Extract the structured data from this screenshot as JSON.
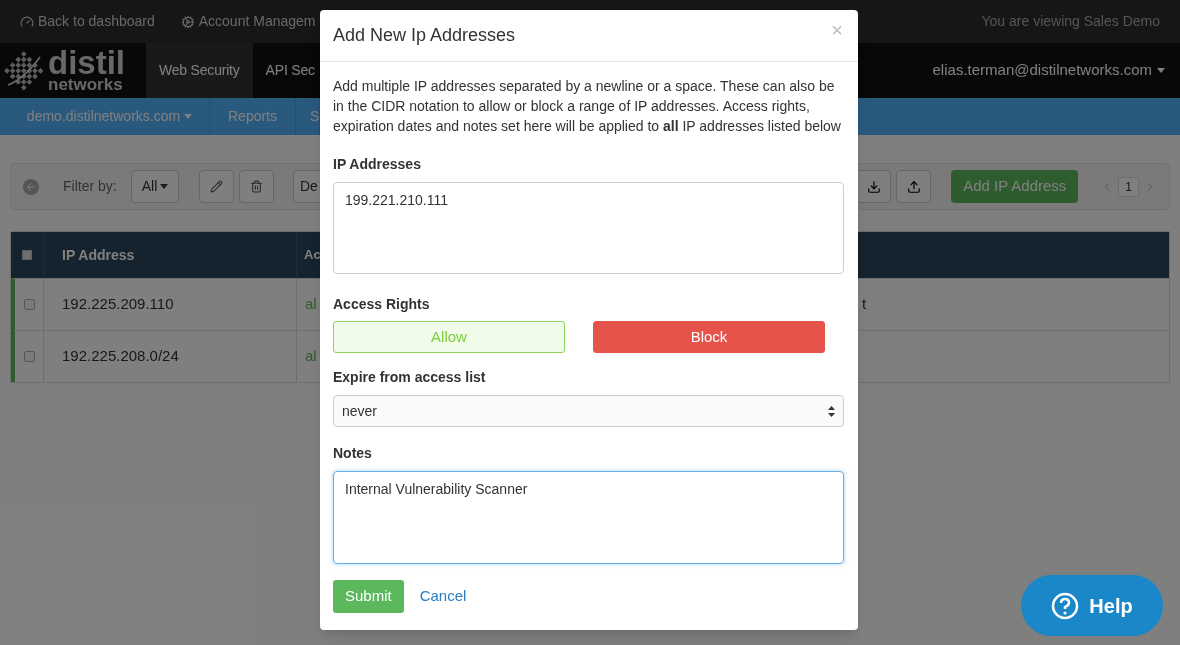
{
  "top_bar": {
    "links": [
      {
        "label": "Back to dashboard"
      },
      {
        "label": "Account Managem"
      }
    ],
    "viewing": "You are viewing Sales Demo"
  },
  "nav": {
    "logo": {
      "word": "distil",
      "sub": "networks"
    },
    "tabs": [
      {
        "label": "Web Security",
        "selected": true
      },
      {
        "label": "API Sec",
        "selected": false
      }
    ],
    "user": "elias.terman@distilnetworks.com"
  },
  "subnav": {
    "items": [
      {
        "label": "demo.distilnetworks.com",
        "dropdown": true
      },
      {
        "label": "Reports",
        "dropdown": false
      },
      {
        "label": "S",
        "dropdown": false
      }
    ]
  },
  "toolbar": {
    "filter_label": "Filter by:",
    "filter_value": "All",
    "cut_button": "De",
    "add_button": "Add IP Address",
    "page": "1"
  },
  "table": {
    "select_all_checked": false,
    "columns": [
      "IP Address",
      "Ac"
    ],
    "rows": [
      {
        "ip": "192.225.209.110",
        "access": "al",
        "column_3": "t",
        "checked": false
      },
      {
        "ip": "192.225.208.0/24",
        "access": "al",
        "checked": false
      }
    ]
  },
  "modal": {
    "title": "Add New Ip Addresses",
    "close": "×",
    "description": "Add multiple IP addresses separated by a newline or a space. These can also be in the CIDR notation to allow or block a range of IP addresses. Access rights, expiration dates and notes set here will be applied to **all** IP addresses listed below",
    "ip_label": "IP Addresses",
    "ip_value": "199.221.210.111",
    "access_label": "Access Rights",
    "access_buttons": [
      {
        "label": "Allow",
        "kind": "allow"
      },
      {
        "label": "Block",
        "kind": "block"
      }
    ],
    "expire_label": "Expire from access list",
    "expire_value": "never",
    "notes_label": "Notes",
    "notes_value": "Internal Vulnerability Scanner",
    "notes_focused": true,
    "submit": "Submit",
    "cancel": "Cancel"
  },
  "help": {
    "label": "Help"
  }
}
